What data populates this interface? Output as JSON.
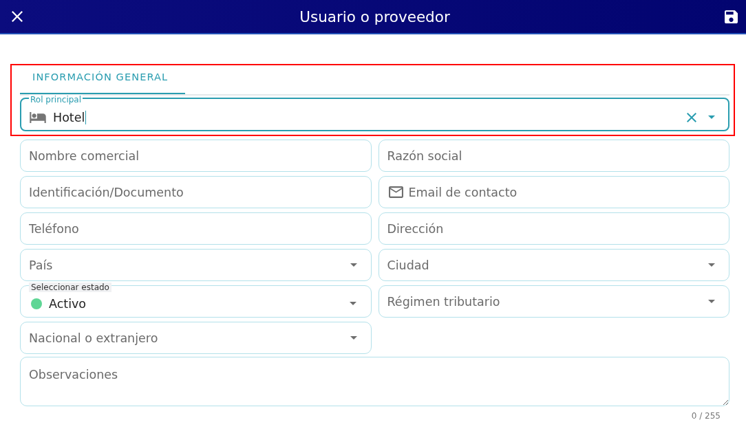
{
  "header": {
    "title": "Usuario o proveedor"
  },
  "tabs": [
    {
      "label": "INFORMACIÓN GENERAL",
      "selected": true
    }
  ],
  "form": {
    "role_field": {
      "label": "Rol principal",
      "value": "Hotel",
      "focused": true
    },
    "fields": [
      {
        "kind": "text",
        "placeholder": "Nombre comercial"
      },
      {
        "kind": "text",
        "placeholder": "Razón social"
      },
      {
        "kind": "text",
        "placeholder": "Identificación/Documento"
      },
      {
        "kind": "email",
        "placeholder": "Email de contacto"
      },
      {
        "kind": "text",
        "placeholder": "Teléfono"
      },
      {
        "kind": "text",
        "placeholder": "Dirección"
      },
      {
        "kind": "select",
        "placeholder": "País"
      },
      {
        "kind": "select",
        "placeholder": "Ciudad"
      },
      {
        "kind": "status",
        "label": "Seleccionar estado",
        "value": "Activo",
        "color": "#5ed695"
      },
      {
        "kind": "select",
        "placeholder": "Régimen tributario"
      },
      {
        "kind": "select",
        "placeholder": "Nacional o extranjero"
      }
    ],
    "notes": {
      "placeholder": "Observaciones",
      "counter": "0 / 255"
    }
  }
}
